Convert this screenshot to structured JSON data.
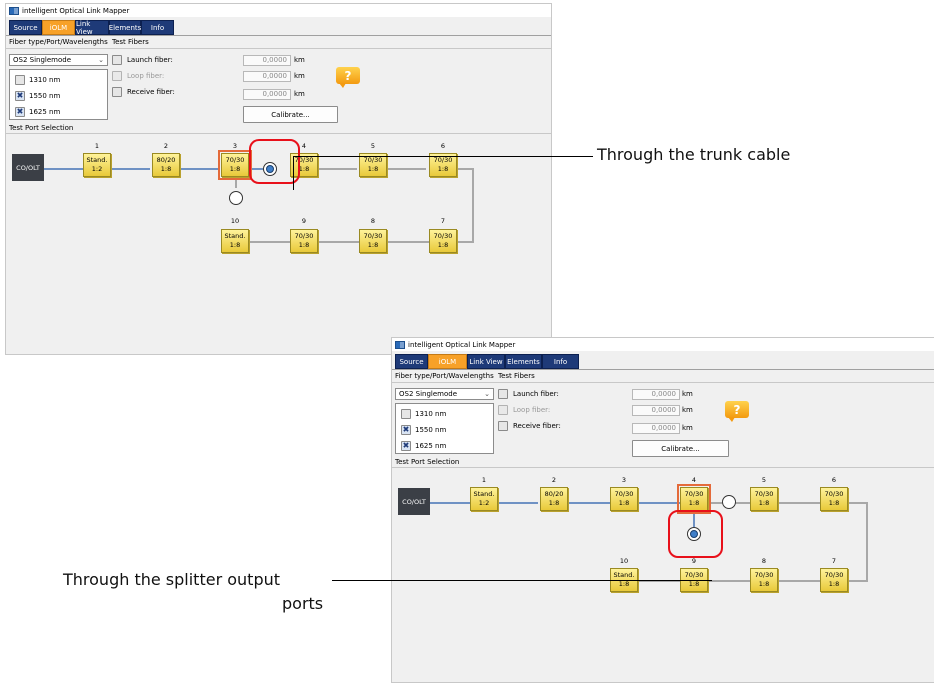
{
  "app_title": "intelligent Optical Link Mapper",
  "tabs": [
    "Source",
    "iOLM",
    "Link View",
    "Elements",
    "Info"
  ],
  "active_tab": "iOLM",
  "section_labels": {
    "fiber": "Fiber type/Port/Wavelengths",
    "test_fibers": "Test Fibers",
    "test_port": "Test Port Selection"
  },
  "fiber_type": "OS2 Singlemode",
  "wavelengths": [
    {
      "label": "1310 nm",
      "checked": false
    },
    {
      "label": "1550 nm",
      "checked": true
    },
    {
      "label": "1625 nm",
      "checked": true
    }
  ],
  "test_fibers": [
    {
      "label": "Launch fiber:",
      "value": "0,0000",
      "unit": "km"
    },
    {
      "label": "Loop fiber:",
      "value": "0,0000",
      "unit": "km"
    },
    {
      "label": "Receive fiber:",
      "value": "0,0000",
      "unit": "km"
    }
  ],
  "calibrate_label": "Calibrate...",
  "help_glyph": "?",
  "olt_label": "CO/OLT",
  "check_mark": "✖",
  "splitters": {
    "s1": {
      "num": "1",
      "l1": "Stand.",
      "l2": "1:2"
    },
    "s2": {
      "num": "2",
      "l1": "80/20",
      "l2": "1:8"
    },
    "s3": {
      "num": "3",
      "l1": "70/30",
      "l2": "1:8"
    },
    "s4": {
      "num": "4",
      "l1": "70/30",
      "l2": "1:8"
    },
    "s5": {
      "num": "5",
      "l1": "70/30",
      "l2": "1:8"
    },
    "s6": {
      "num": "6",
      "l1": "70/30",
      "l2": "1:8"
    },
    "s7": {
      "num": "7",
      "l1": "70/30",
      "l2": "1:8"
    },
    "s8": {
      "num": "8",
      "l1": "70/30",
      "l2": "1:8"
    },
    "s9": {
      "num": "9",
      "l1": "70/30",
      "l2": "1:8"
    },
    "s10": {
      "num": "10",
      "l1": "Stand.",
      "l2": "1:8"
    }
  },
  "callouts": {
    "trunk": "Through the trunk cable",
    "splitter_line1": "Through the splitter output",
    "splitter_line2": "ports"
  },
  "colors": {
    "tab_active": "#f7a128",
    "tab": "#1e3a78",
    "highlight": "#e8101a",
    "splitter": "#f1dc5a"
  }
}
